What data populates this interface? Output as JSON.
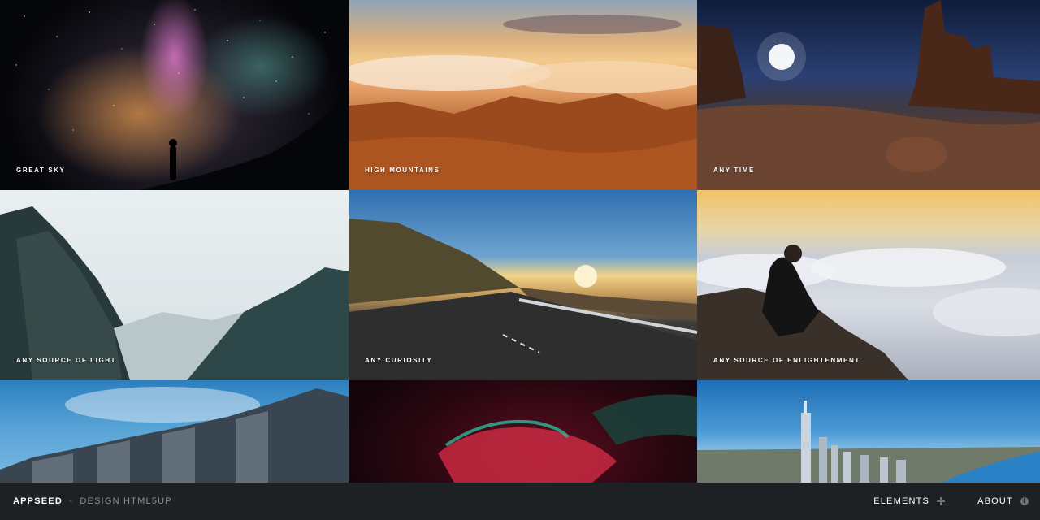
{
  "gallery": {
    "tiles": [
      {
        "caption": "Great Sky"
      },
      {
        "caption": "High Mountains"
      },
      {
        "caption": "Any Time"
      },
      {
        "caption": "Any Source of Light"
      },
      {
        "caption": "Any Curiosity"
      },
      {
        "caption": "Any Source of Enlightenment"
      },
      {
        "caption": ""
      },
      {
        "caption": ""
      },
      {
        "caption": ""
      }
    ]
  },
  "footer": {
    "brand_name": "AppSeed",
    "brand_separator": "-",
    "brand_credit": "Design HTML5UP",
    "nav": [
      {
        "label": "Elements",
        "icon": "plus-icon"
      },
      {
        "label": "About",
        "icon": "info-icon",
        "glyph": "i"
      }
    ]
  }
}
